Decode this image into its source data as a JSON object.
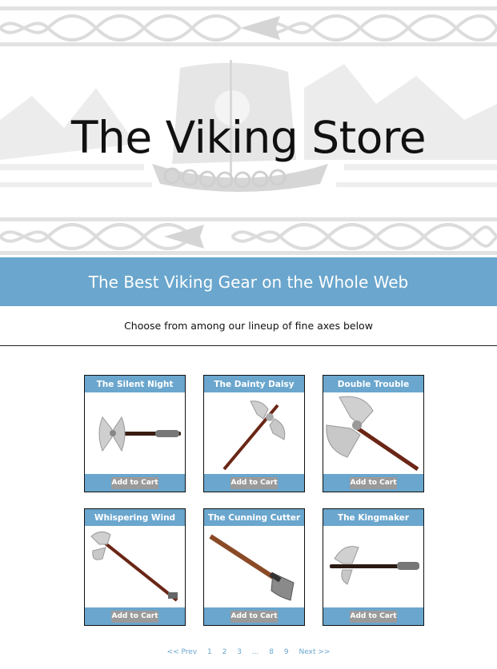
{
  "header": {
    "title": "The Viking Store"
  },
  "tagline": "The Best Viking Gear on the Whole Web",
  "subtitle": "Choose from among our lineup of fine axes below",
  "products": [
    {
      "name": "The Silent Night",
      "button": "Add to Cart"
    },
    {
      "name": "The Dainty Daisy",
      "button": "Add to Cart"
    },
    {
      "name": "Double Trouble",
      "button": "Add to Cart"
    },
    {
      "name": "Whispering Wind",
      "button": "Add to Cart"
    },
    {
      "name": "The Cunning Cutter",
      "button": "Add to Cart"
    },
    {
      "name": "The Kingmaker",
      "button": "Add to Cart"
    }
  ],
  "pagination": {
    "prev": "<< Prev",
    "pages": [
      "1",
      "2",
      "3",
      "...",
      "8",
      "9"
    ],
    "next": "Next >>"
  },
  "colors": {
    "accent": "#6aa6cd",
    "button": "#9a9a9a"
  }
}
